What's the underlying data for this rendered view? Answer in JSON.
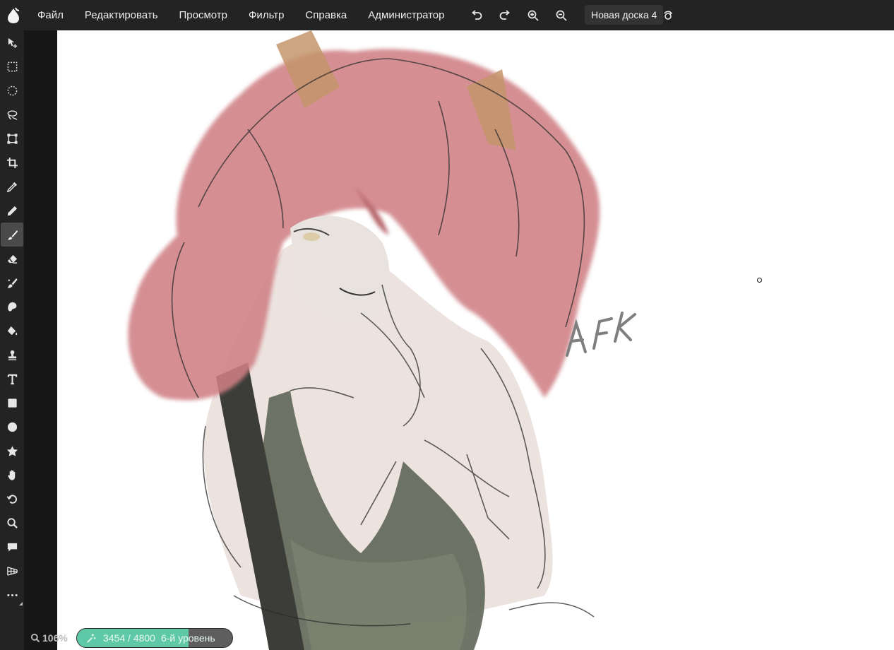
{
  "menu": {
    "items": [
      "Файл",
      "Редактировать",
      "Просмотр",
      "Фильтр",
      "Справка",
      "Администратор"
    ]
  },
  "toolbar_top": {
    "icons": [
      "undo-icon",
      "redo-icon",
      "zoom-in-icon",
      "zoom-out-icon",
      "magic-icon",
      "broadcast-icon",
      "expand-icon",
      "community-icon"
    ]
  },
  "board": {
    "name": "Новая доска 4"
  },
  "tools": [
    "move-icon",
    "rect-select-icon",
    "ellipse-select-icon",
    "lasso-icon",
    "transform-icon",
    "crop-icon",
    "eyedropper-icon",
    "pencil-icon",
    "brush-icon",
    "eraser-icon",
    "mixer-brush-icon",
    "smudge-icon",
    "bucket-icon",
    "stamp-icon",
    "text-icon",
    "rectangle-icon",
    "ellipse-icon",
    "shape-icon",
    "hand-icon",
    "rotate-icon",
    "zoom-icon",
    "comment-icon",
    "perspective-icon",
    "more-icon"
  ],
  "active_tool": "brush-icon",
  "status": {
    "zoom": "106%",
    "xp_text": "3454 / 4800",
    "level": "6-й уровень",
    "xp_fraction": 0.72
  },
  "colors": {
    "accent": "#5fc9a7",
    "hair": "#cf8084",
    "dress": "#5f6656"
  },
  "artwork": {
    "signature": "AFK"
  }
}
